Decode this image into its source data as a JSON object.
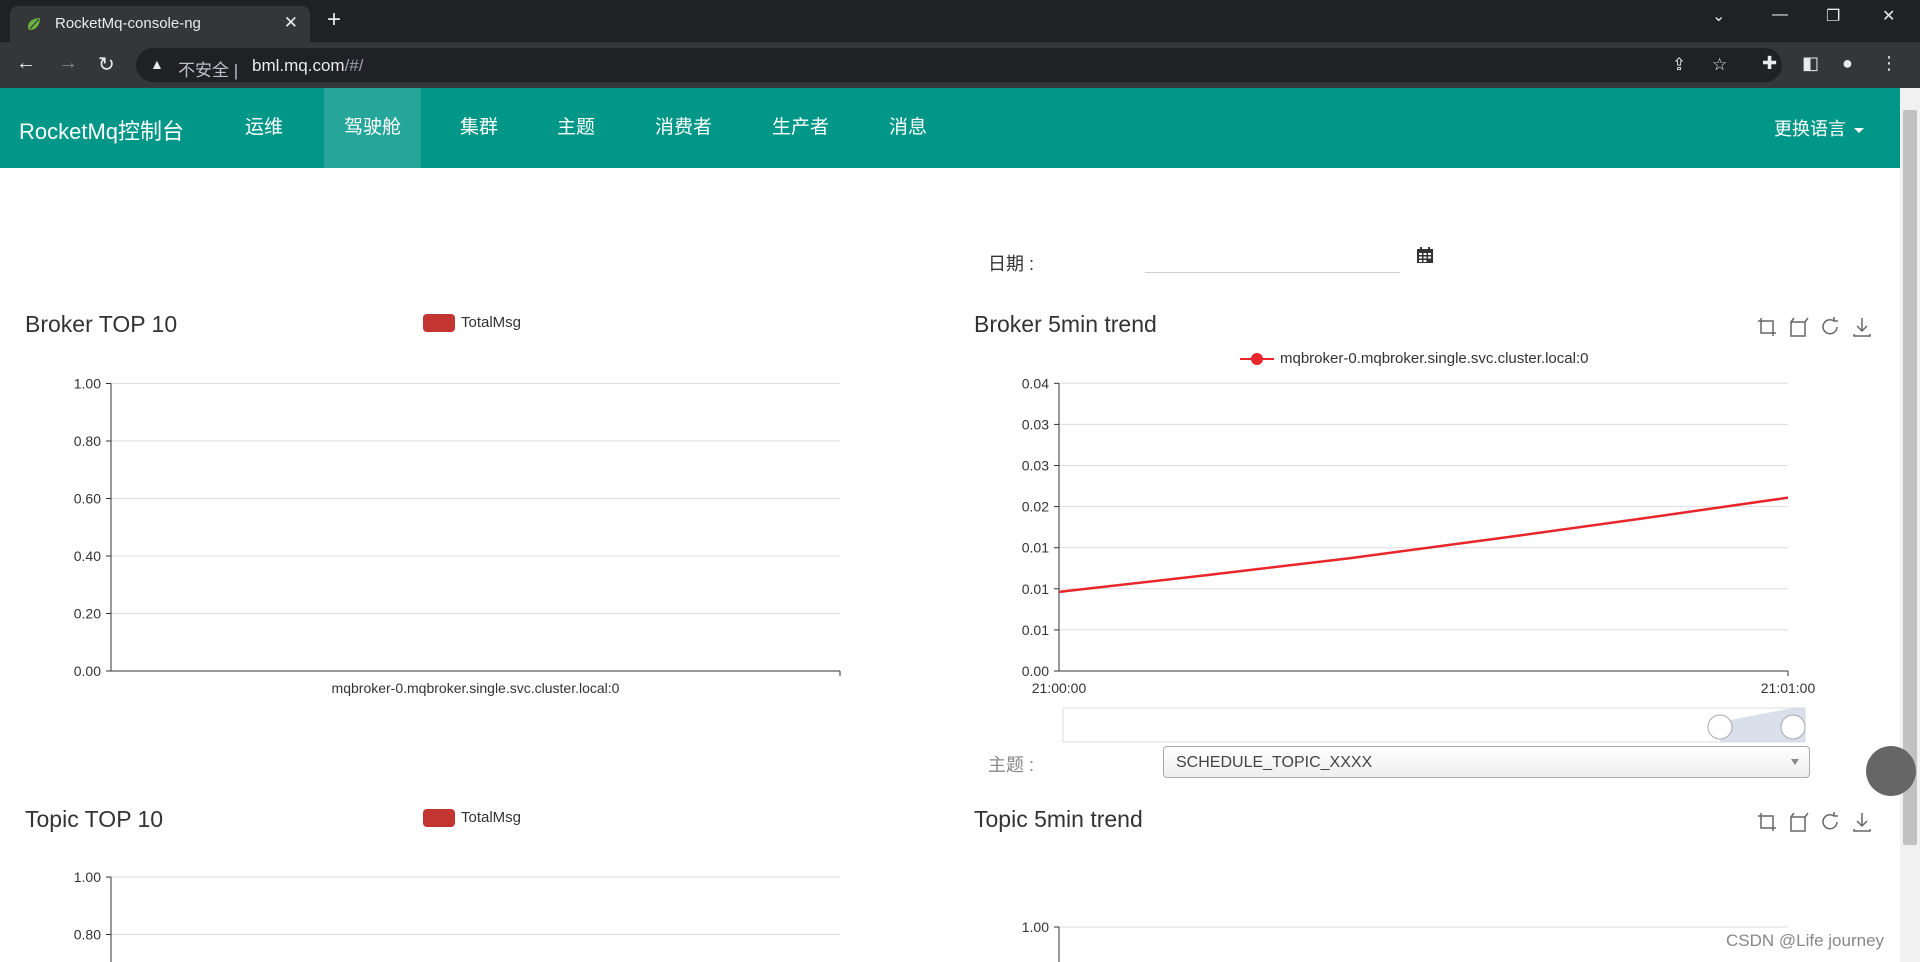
{
  "browser": {
    "tab_title": "RocketMq-console-ng",
    "insecure_label": "不安全",
    "url_host": "bml.mq.com",
    "url_path": "/#/"
  },
  "nav": {
    "brand": "RocketMq控制台",
    "items": [
      {
        "label": "运维",
        "active": false
      },
      {
        "label": "驾驶舱",
        "active": true
      },
      {
        "label": "集群",
        "active": false
      },
      {
        "label": "主题",
        "active": false
      },
      {
        "label": "消费者",
        "active": false
      },
      {
        "label": "生产者",
        "active": false
      },
      {
        "label": "消息",
        "active": false
      }
    ],
    "language": "更换语言"
  },
  "filters": {
    "date_label": "日期 :",
    "date_value": "",
    "topic_label": "主题 :",
    "topic_value": "SCHEDULE_TOPIC_XXXX"
  },
  "panels": {
    "broker_top": {
      "title": "Broker TOP 10",
      "legend": "TotalMsg"
    },
    "broker_trend": {
      "title": "Broker 5min trend",
      "legend": "mqbroker-0.mqbroker.single.svc.cluster.local:0"
    },
    "topic_top": {
      "title": "Topic TOP 10",
      "legend": "TotalMsg"
    },
    "topic_trend": {
      "title": "Topic 5min trend"
    }
  },
  "watermark": "CSDN @Life  journey",
  "colors": {
    "nav": "#009688",
    "nav_active": "#26a69a",
    "bar": "#c23531",
    "line": "#e8262b"
  },
  "chart_data": [
    {
      "type": "bar",
      "title": "Broker TOP 10",
      "legend": [
        "TotalMsg"
      ],
      "categories": [
        "mqbroker-0.mqbroker.single.svc.cluster.local:0"
      ],
      "series": [
        {
          "name": "TotalMsg",
          "values": [
            0
          ]
        }
      ],
      "yticks": [
        "0.00",
        "0.20",
        "0.40",
        "0.60",
        "0.80",
        "1.00"
      ],
      "ylim": [
        0,
        1
      ],
      "grid": true
    },
    {
      "type": "line",
      "title": "Broker 5min trend",
      "legend": [
        "mqbroker-0.mqbroker.single.svc.cluster.local:0"
      ],
      "xticks": [
        "21:00:00",
        "21:01:00"
      ],
      "yticks": [
        "0.00",
        "0.01",
        "0.01",
        "0.01",
        "0.02",
        "0.03",
        "0.03",
        "0.04"
      ],
      "ylim": [
        0,
        0.035
      ],
      "series": [
        {
          "name": "mqbroker-0.mqbroker.single.svc.cluster.local:0",
          "values": [
            0.011,
            0.0133,
            0.0157,
            0.0184,
            0.0212,
            0.0241
          ]
        }
      ],
      "grid": true,
      "dataZoom": true
    },
    {
      "type": "bar",
      "title": "Topic TOP 10",
      "legend": [
        "TotalMsg"
      ],
      "yticks": [
        "0.80",
        "1.00"
      ],
      "grid": true
    },
    {
      "type": "line",
      "title": "Topic 5min trend",
      "yticks": [
        "1.00"
      ],
      "grid": true
    }
  ]
}
